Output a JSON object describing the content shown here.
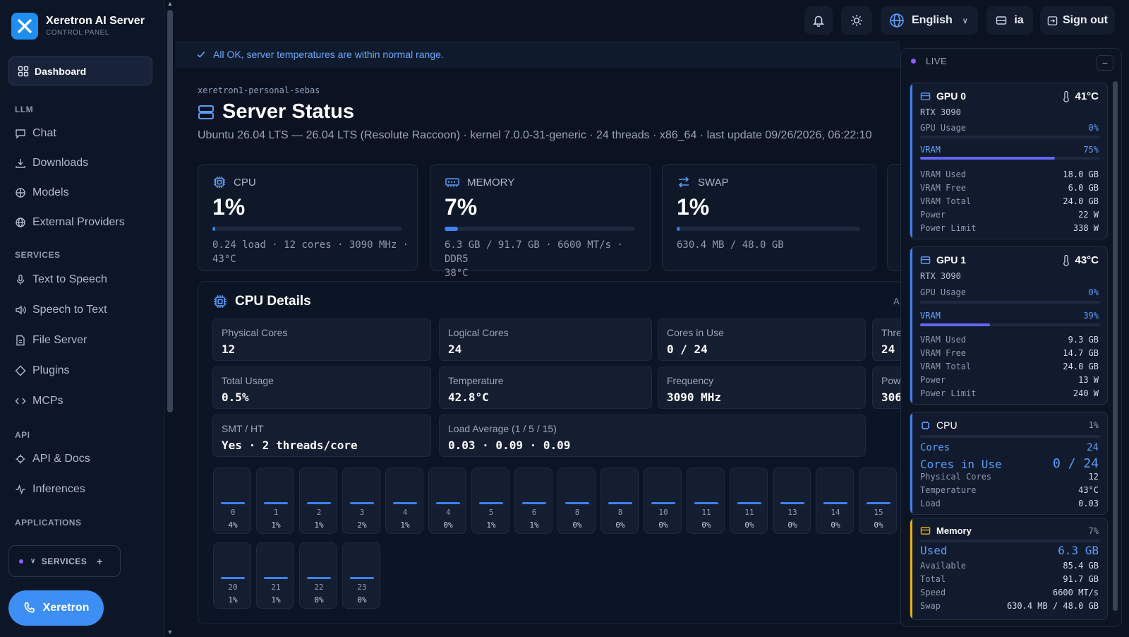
{
  "brand": {
    "name": "Xeretron AI Server",
    "subtitle": "CONTROL PANEL"
  },
  "nav": {
    "active": "Dashboard",
    "sections": [
      {
        "title": "LLM",
        "items": [
          "Chat",
          "Downloads",
          "Models",
          "External Providers"
        ]
      },
      {
        "title": "SERVICES",
        "items": [
          "Text to Speech",
          "Speech to Text",
          "File Server",
          "Plugins",
          "MCPs"
        ]
      },
      {
        "title": "API",
        "items": [
          "API & Docs",
          "Inferences"
        ]
      },
      {
        "title": "APPLICATIONS",
        "items": []
      }
    ],
    "services_pill": "SERVICES",
    "call_button": "Xeretron"
  },
  "topbar": {
    "language": "English",
    "user": "ia",
    "signout": "Sign out"
  },
  "banner": "All OK, server temperatures are within normal range.",
  "page": {
    "host": "xeretron1-personal-sebas",
    "title": "Server Status",
    "subtitle": "Ubuntu 26.04 LTS — 26.04 LTS (Resolute Raccoon) · kernel 7.0.0-31-generic · 24 threads · x86_64 · last update 09/26/2026, 06:22:10"
  },
  "cards": {
    "cpu": {
      "label": "CPU",
      "value": "1%",
      "percent": 1,
      "detail": "0.24 load · 12 cores · 3090 MHz ·",
      "detail2": "43°C"
    },
    "memory": {
      "label": "MEMORY",
      "value": "7%",
      "percent": 7,
      "detail": "6.3 GB / 91.7 GB · 6600 MT/s · DDR5",
      "detail2": "38°C"
    },
    "swap": {
      "label": "SWAP",
      "value": "1%",
      "percent": 1,
      "detail": "630.4 MB / 48.0 GB"
    }
  },
  "cpu_details": {
    "title": "CPU Details",
    "right_label": "A",
    "tiles": [
      {
        "label": "Physical Cores",
        "value": "12"
      },
      {
        "label": "Logical Cores",
        "value": "24"
      },
      {
        "label": "Cores in Use",
        "value": "0 / 24"
      },
      {
        "label": "Thre",
        "value": "24"
      },
      {
        "label": "Total Usage",
        "value": "0.5%"
      },
      {
        "label": "Temperature",
        "value": "42.8°C"
      },
      {
        "label": "Frequency",
        "value": "3090 MHz"
      },
      {
        "label": "Pow",
        "value": "306"
      },
      {
        "label": "SMT / HT",
        "value": "Yes · 2 threads/core"
      },
      {
        "label": "Load Average (1 / 5 / 15)",
        "value": "0.03 · 0.09 · 0.09"
      }
    ],
    "cores": [
      {
        "n": "0",
        "p": "4%"
      },
      {
        "n": "1",
        "p": "1%"
      },
      {
        "n": "2",
        "p": "1%"
      },
      {
        "n": "3",
        "p": "2%"
      },
      {
        "n": "4",
        "p": "1%"
      },
      {
        "n": "4",
        "p": "0%"
      },
      {
        "n": "5",
        "p": "1%"
      },
      {
        "n": "6",
        "p": "1%"
      },
      {
        "n": "8",
        "p": "0%"
      },
      {
        "n": "8",
        "p": "0%"
      },
      {
        "n": "10",
        "p": "0%"
      },
      {
        "n": "11",
        "p": "0%"
      },
      {
        "n": "11",
        "p": "0%"
      },
      {
        "n": "13",
        "p": "0%"
      },
      {
        "n": "14",
        "p": "0%"
      },
      {
        "n": "15",
        "p": "0%"
      },
      {
        "n": "20",
        "p": "1%"
      },
      {
        "n": "21",
        "p": "1%"
      },
      {
        "n": "22",
        "p": "0%"
      },
      {
        "n": "23",
        "p": "0%"
      }
    ]
  },
  "live": {
    "label": "LIVE",
    "minimize": "−",
    "gpus": [
      {
        "name": "GPU 0",
        "temp": "41°C",
        "model": "RTX 3090",
        "usage_label": "GPU Usage",
        "usage": "0%",
        "vram_label": "VRAM",
        "vram": "75%",
        "vram_pct": 75,
        "rows": [
          [
            "VRAM Used",
            "18.0 GB"
          ],
          [
            "VRAM Free",
            "6.0 GB"
          ],
          [
            "VRAM Total",
            "24.0 GB"
          ],
          [
            "Power",
            "22 W"
          ],
          [
            "Power Limit",
            "338 W"
          ]
        ]
      },
      {
        "name": "GPU 1",
        "temp": "43°C",
        "model": "RTX 3090",
        "usage_label": "GPU Usage",
        "usage": "0%",
        "vram_label": "VRAM",
        "vram": "39%",
        "vram_pct": 39,
        "rows": [
          [
            "VRAM Used",
            "9.3 GB"
          ],
          [
            "VRAM Free",
            "14.7 GB"
          ],
          [
            "VRAM Total",
            "24.0 GB"
          ],
          [
            "Power",
            "13 W"
          ],
          [
            "Power Limit",
            "240 W"
          ]
        ]
      }
    ],
    "cpu": {
      "name": "CPU",
      "pct": "1%",
      "cores_label": "Cores",
      "cores": "24",
      "inuse_label": "Cores in Use",
      "inuse": "0 / 24",
      "rows": [
        [
          "Physical Cores",
          "12"
        ],
        [
          "Temperature",
          "43°C"
        ],
        [
          "Load",
          "0.03"
        ]
      ]
    },
    "memory": {
      "name": "Memory",
      "pct": "7%",
      "used_label": "Used",
      "used": "6.3 GB",
      "rows": [
        [
          "Available",
          "85.4 GB"
        ],
        [
          "Total",
          "91.7 GB"
        ],
        [
          "Speed",
          "6600 MT/s"
        ],
        [
          "Swap",
          "630.4 MB / 48.0 GB"
        ]
      ]
    }
  }
}
